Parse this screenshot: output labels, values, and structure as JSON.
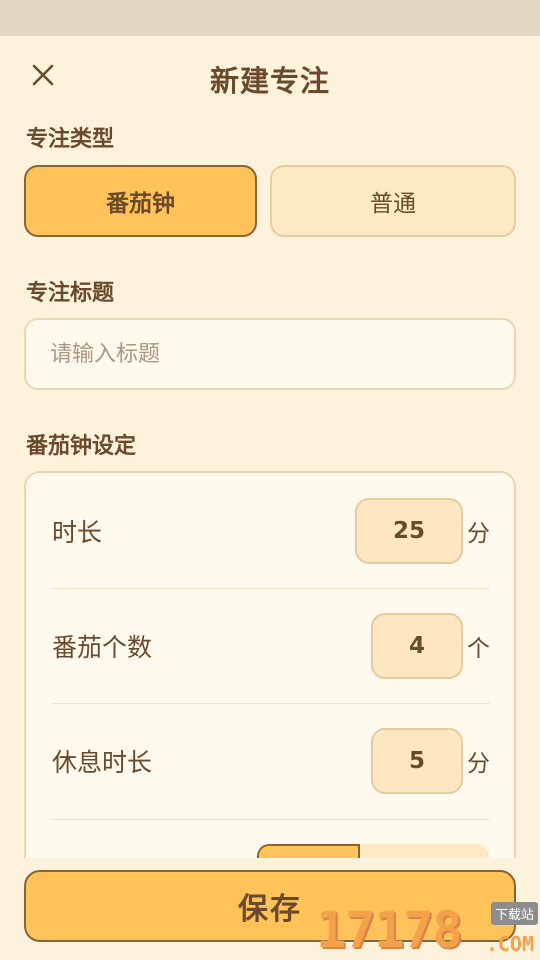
{
  "header": {
    "title": "新建专注",
    "close_icon": "close-icon"
  },
  "focus_type": {
    "label": "专注类型",
    "options": [
      "番茄钟",
      "普通"
    ],
    "selected": "番茄钟"
  },
  "focus_title": {
    "label": "专注标题",
    "value": "",
    "placeholder": "请输入标题"
  },
  "pomodoro_settings": {
    "label": "番茄钟设定",
    "rows": [
      {
        "label": "时长",
        "value": "25",
        "unit": "分"
      },
      {
        "label": "番茄个数",
        "value": "4",
        "unit": "个"
      },
      {
        "label": "休息时长",
        "value": "5",
        "unit": "分"
      }
    ]
  },
  "footer": {
    "save_label": "保存"
  },
  "watermark": {
    "digits": "17178",
    "dotcom": ".COM",
    "tag": "下载站"
  },
  "colors": {
    "background": "#fdf2dc",
    "accent": "#ffc35a",
    "accent_border": "#8a6438",
    "text": "#6b4a2b",
    "status_bar": "#e1d6bf"
  }
}
